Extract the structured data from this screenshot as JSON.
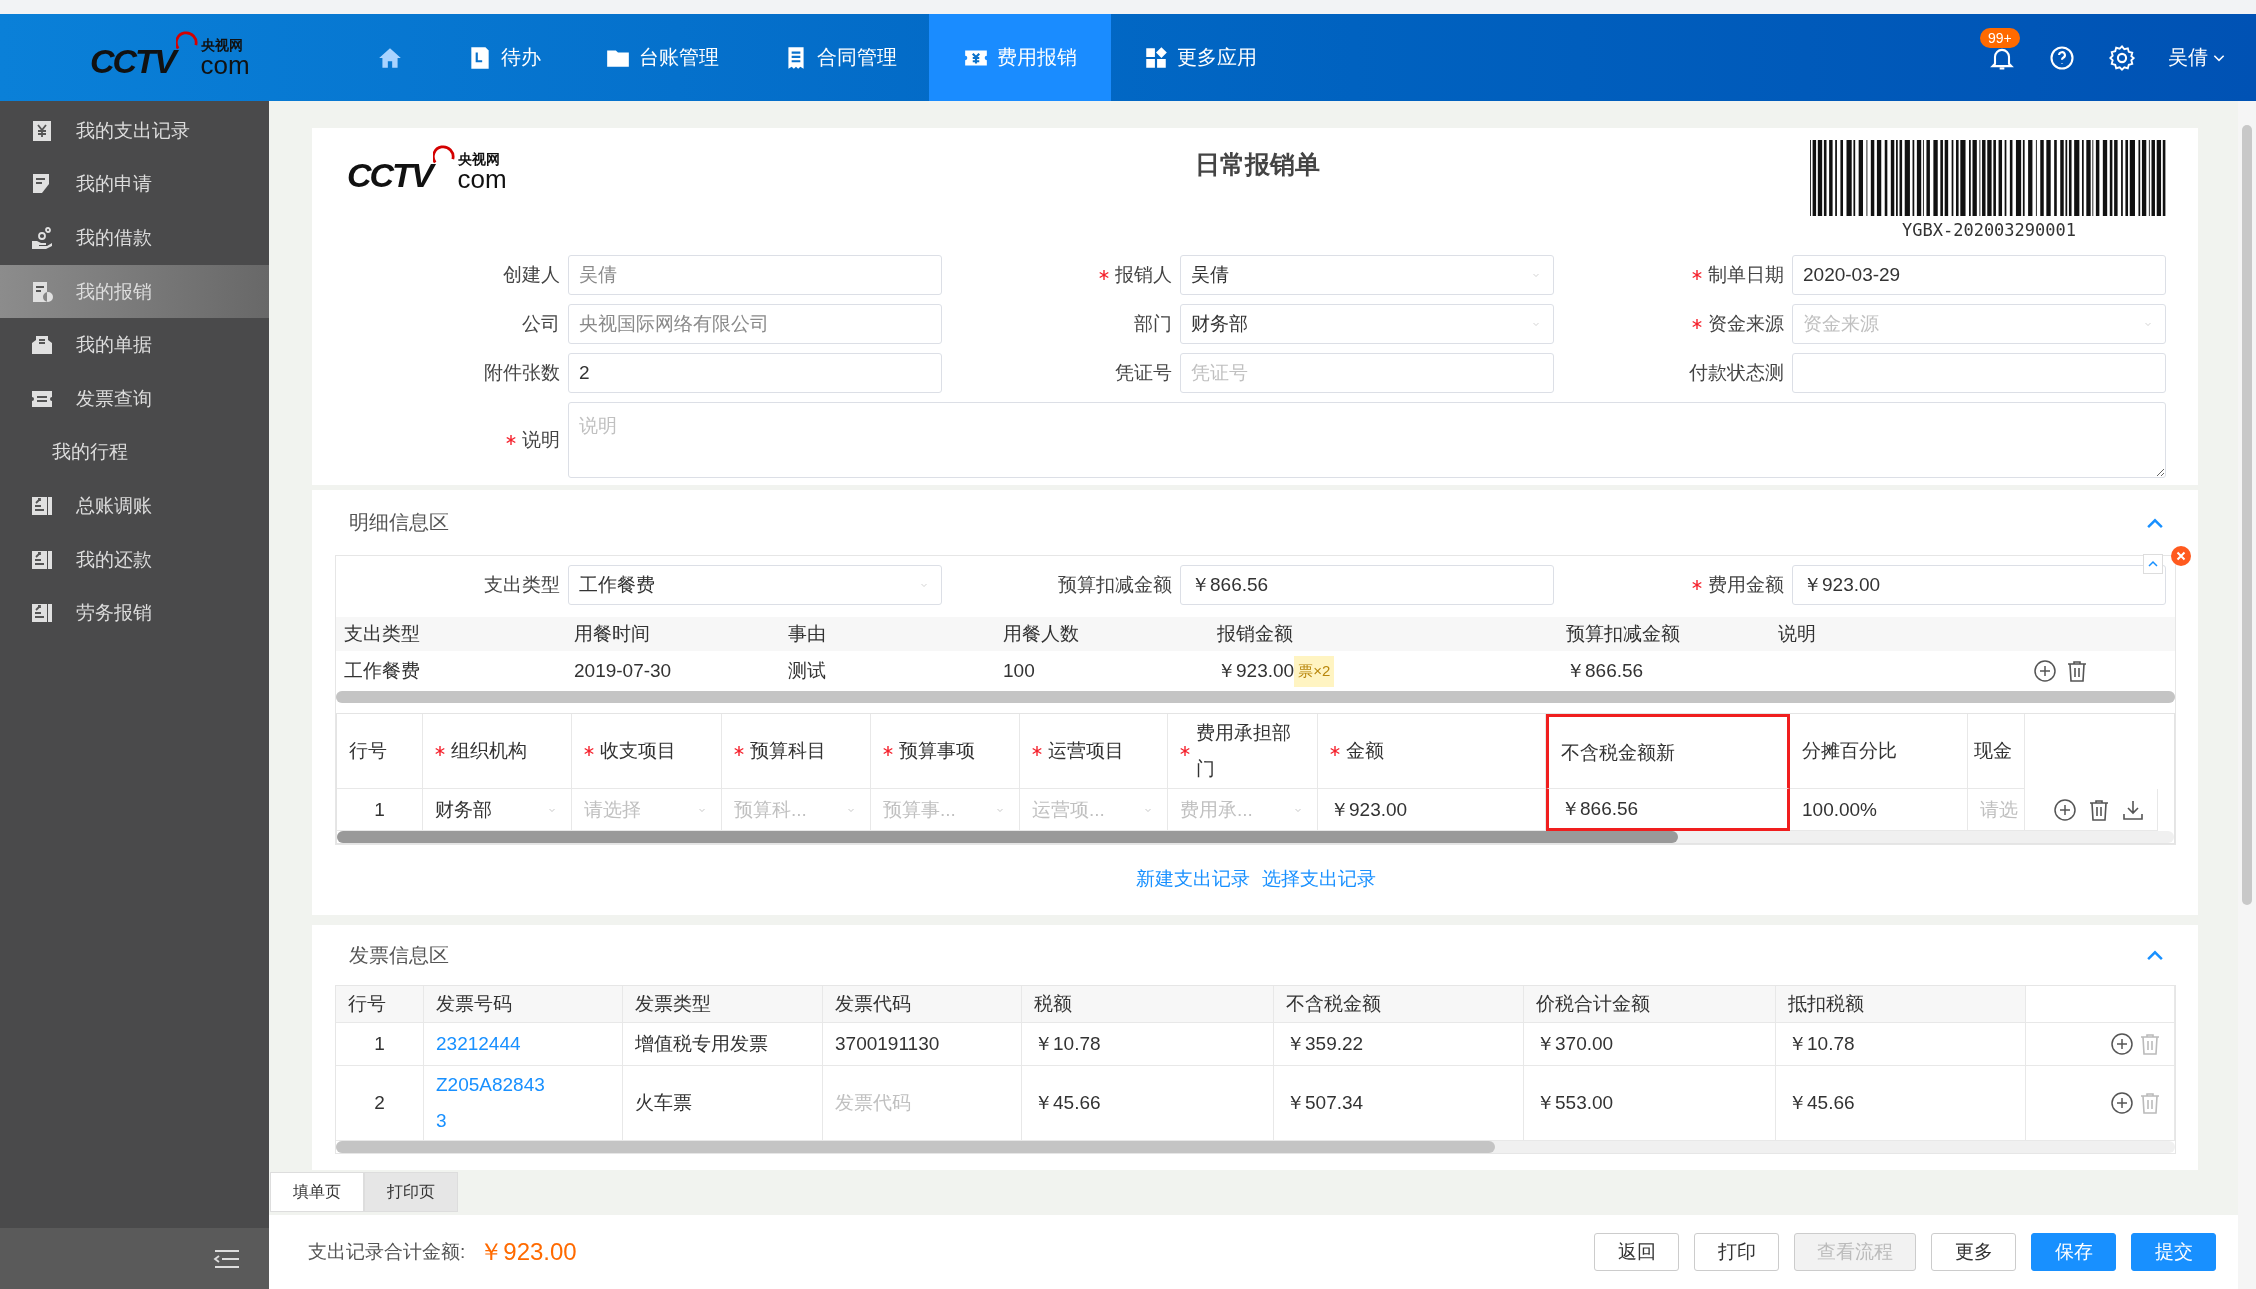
{
  "header": {
    "logo": {
      "mark": "CCTV",
      "cn": "央视网",
      "suffix": "com"
    },
    "nav": [
      {
        "kind": "home",
        "selected": false
      },
      {
        "kind": "todo",
        "label": "待办",
        "selected": false
      },
      {
        "kind": "folder",
        "label": "台账管理",
        "selected": false
      },
      {
        "kind": "contract",
        "label": "合同管理",
        "selected": false
      },
      {
        "kind": "expense",
        "label": "费用报销",
        "selected": true
      },
      {
        "kind": "apps",
        "label": "更多应用",
        "selected": false
      }
    ],
    "notification_badge": "99+",
    "user": "吴倩"
  },
  "sidebar": {
    "items": [
      {
        "kind": "expense",
        "label": "我的支出记录",
        "selected": false
      },
      {
        "kind": "application",
        "label": "我的申请",
        "selected": false
      },
      {
        "kind": "loan",
        "label": "我的借款",
        "selected": false
      },
      {
        "kind": "reimburse",
        "label": "我的报销",
        "selected": true
      },
      {
        "kind": "document",
        "label": "我的单据",
        "selected": false
      },
      {
        "kind": "invoice",
        "label": "发票查询",
        "selected": false
      },
      {
        "kind": "none",
        "label": "我的行程",
        "selected": false
      },
      {
        "kind": "ledger",
        "label": "总账调账",
        "selected": false
      },
      {
        "kind": "ledger",
        "label": "我的还款",
        "selected": false
      },
      {
        "kind": "ledger",
        "label": "劳务报销",
        "selected": false
      }
    ]
  },
  "form": {
    "logo": {
      "mark": "CCTV",
      "cn": "央视网",
      "suffix": "com"
    },
    "title": "日常报销单",
    "barcode_number": "YGBX-202003290001",
    "fields": [
      {
        "label": "创建人",
        "required": false,
        "kind": "text",
        "value": "吴倩",
        "readonly": true
      },
      {
        "label": "报销人",
        "required": true,
        "kind": "select",
        "value": "吴倩",
        "readonly": false
      },
      {
        "label": "制单日期",
        "required": true,
        "kind": "text",
        "value": "2020-03-29",
        "readonly": false
      },
      {
        "label": "公司",
        "required": false,
        "kind": "text",
        "value": "央视国际网络有限公司",
        "readonly": true
      },
      {
        "label": "部门",
        "required": false,
        "kind": "select",
        "value": "财务部",
        "readonly": false
      },
      {
        "label": "资金来源",
        "required": true,
        "kind": "select",
        "placeholder": "资金来源"
      },
      {
        "label": "附件张数",
        "required": false,
        "kind": "text",
        "value": "2",
        "readonly": false
      },
      {
        "label": "凭证号",
        "required": false,
        "kind": "text",
        "placeholder": "凭证号"
      },
      {
        "label": "付款状态测",
        "required": false,
        "kind": "text"
      },
      {
        "label": "说明",
        "required": true,
        "kind": "textarea",
        "placeholder": "说明"
      }
    ]
  },
  "detail": {
    "title": "明细信息区",
    "fields": [
      {
        "label": "支出类型",
        "required": false,
        "kind": "select",
        "value": "工作餐费"
      },
      {
        "label": "预算扣减金额",
        "required": false,
        "kind": "text",
        "value": "￥866.56"
      },
      {
        "label": "费用金额",
        "required": true,
        "kind": "text",
        "value": "￥923.00"
      }
    ],
    "summary": {
      "columns": [
        "支出类型",
        "用餐时间",
        "事由",
        "用餐人数",
        "报销金额",
        "预算扣减金额",
        "说明"
      ],
      "rows": [
        {
          "cells": [
            {
              "text": "工作餐费"
            },
            {
              "text": "2019-07-30"
            },
            {
              "text": "测试"
            },
            {
              "text": "100"
            },
            {
              "text": "￥923.00",
              "badge": "票×2"
            },
            {
              "text": "￥866.56"
            }
          ]
        }
      ]
    },
    "allocation": {
      "columns": [
        {
          "label": "行号",
          "required": false,
          "highlighted": false
        },
        {
          "label": "组织机构",
          "required": true,
          "highlighted": false
        },
        {
          "label": "收支项目",
          "required": true,
          "highlighted": false
        },
        {
          "label": "预算科目",
          "required": true,
          "highlighted": false
        },
        {
          "label": "预算事项",
          "required": true,
          "highlighted": false
        },
        {
          "label": "运营项目",
          "required": true,
          "highlighted": false
        },
        {
          "label": "费用承担部门",
          "required": true,
          "highlighted": false
        },
        {
          "label": "金额",
          "required": true,
          "highlighted": false
        },
        {
          "label": "不含税金额新",
          "required": false,
          "highlighted": true
        },
        {
          "label": "分摊百分比",
          "required": false,
          "highlighted": false
        },
        {
          "label": "现金",
          "required": false,
          "highlighted": false
        }
      ],
      "rows": [
        {
          "cells": [
            {
              "kind": "text",
              "value": "1"
            },
            {
              "kind": "select",
              "value": "财务部"
            },
            {
              "kind": "select",
              "placeholder": "请选择"
            },
            {
              "kind": "select",
              "placeholder": "预算科..."
            },
            {
              "kind": "select",
              "placeholder": "预算事..."
            },
            {
              "kind": "select",
              "placeholder": "运营项..."
            },
            {
              "kind": "select",
              "placeholder": "费用承..."
            },
            {
              "kind": "text",
              "value": "￥923.00"
            },
            {
              "kind": "text",
              "value": "￥866.56"
            },
            {
              "kind": "text",
              "value": "100.00%"
            },
            {
              "kind": "text",
              "placeholder": "请选"
            }
          ]
        }
      ]
    },
    "links": [
      "新建支出记录",
      "选择支出记录"
    ]
  },
  "invoices": {
    "title": "发票信息区",
    "columns": [
      "行号",
      "发票号码",
      "发票类型",
      "发票代码",
      "税额",
      "不含税金额",
      "价税合计金额",
      "抵扣税额"
    ],
    "rows": [
      {
        "index": "1",
        "number": "23212444",
        "type": "增值税专用发票",
        "code": "3700191130",
        "tax": "￥10.78",
        "net": "￥359.22",
        "gross": "￥370.00",
        "deductible": "￥10.78"
      },
      {
        "index": "2",
        "number": "Z205A828433",
        "type": "火车票",
        "code_placeholder": "发票代码",
        "tax": "￥45.66",
        "net": "￥507.34",
        "gross": "￥553.00",
        "deductible": "￥45.66"
      }
    ]
  },
  "tabs": [
    {
      "label": "填单页",
      "selected": true
    },
    {
      "label": "打印页",
      "selected": false
    }
  ],
  "footer": {
    "total_label": "支出记录合计金额:",
    "total": "￥923.00",
    "buttons": [
      {
        "label": "返回",
        "kind": "default"
      },
      {
        "label": "打印",
        "kind": "default"
      },
      {
        "label": "查看流程",
        "kind": "disabled"
      },
      {
        "label": "更多",
        "kind": "default"
      },
      {
        "label": "保存",
        "kind": "primary"
      },
      {
        "label": "提交",
        "kind": "primary"
      }
    ]
  }
}
